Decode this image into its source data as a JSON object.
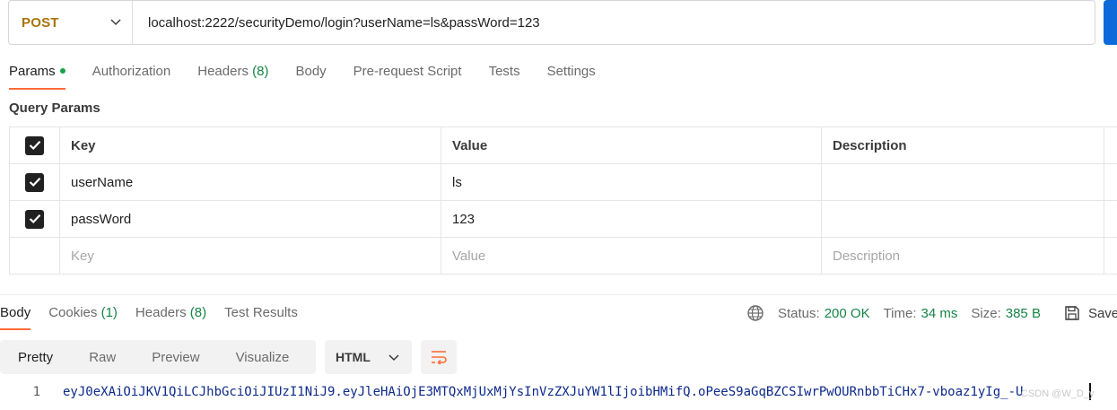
{
  "request": {
    "method": "POST",
    "url": "localhost:2222/securityDemo/login?userName=ls&passWord=123"
  },
  "request_tabs": [
    {
      "label": "Params",
      "active": true,
      "dot": true
    },
    {
      "label": "Authorization"
    },
    {
      "label": "Headers",
      "count": "(8)"
    },
    {
      "label": "Body"
    },
    {
      "label": "Pre-request Script"
    },
    {
      "label": "Tests"
    },
    {
      "label": "Settings"
    }
  ],
  "query_params": {
    "title": "Query Params",
    "headers": {
      "key": "Key",
      "value": "Value",
      "description": "Description"
    },
    "rows": [
      {
        "key": "userName",
        "value": "ls",
        "description": "",
        "checked": true
      },
      {
        "key": "passWord",
        "value": "123",
        "description": "",
        "checked": true
      }
    ],
    "placeholders": {
      "key": "Key",
      "value": "Value",
      "description": "Description"
    }
  },
  "response_tabs": [
    {
      "label": "Body",
      "active": true
    },
    {
      "label": "Cookies",
      "count": "(1)"
    },
    {
      "label": "Headers",
      "count": "(8)"
    },
    {
      "label": "Test Results"
    }
  ],
  "response_meta": {
    "status_label": "Status:",
    "status_value": "200 OK",
    "time_label": "Time:",
    "time_value": "34 ms",
    "size_label": "Size:",
    "size_value": "385 B",
    "save_label": "Save"
  },
  "view_modes": [
    "Pretty",
    "Raw",
    "Preview",
    "Visualize"
  ],
  "format": "HTML",
  "code": {
    "line_number": "1",
    "text": "eyJ0eXAiOiJKV1QiLCJhbGciOiJIUzI1NiJ9.eyJleHAiOjE3MTQxMjUxMjYsInVzZXJuYW1lIjoibHMifQ.oPeeS9aGqBZCSIwrPwOURnbbTiCHx7-vboaz1yIg_-U"
  },
  "watermark": "CSDN @W_D_y",
  "colors": {
    "method": "#a8730a",
    "accent": "#ff6c37",
    "success": "#168445",
    "send": "#0c6bd8"
  }
}
